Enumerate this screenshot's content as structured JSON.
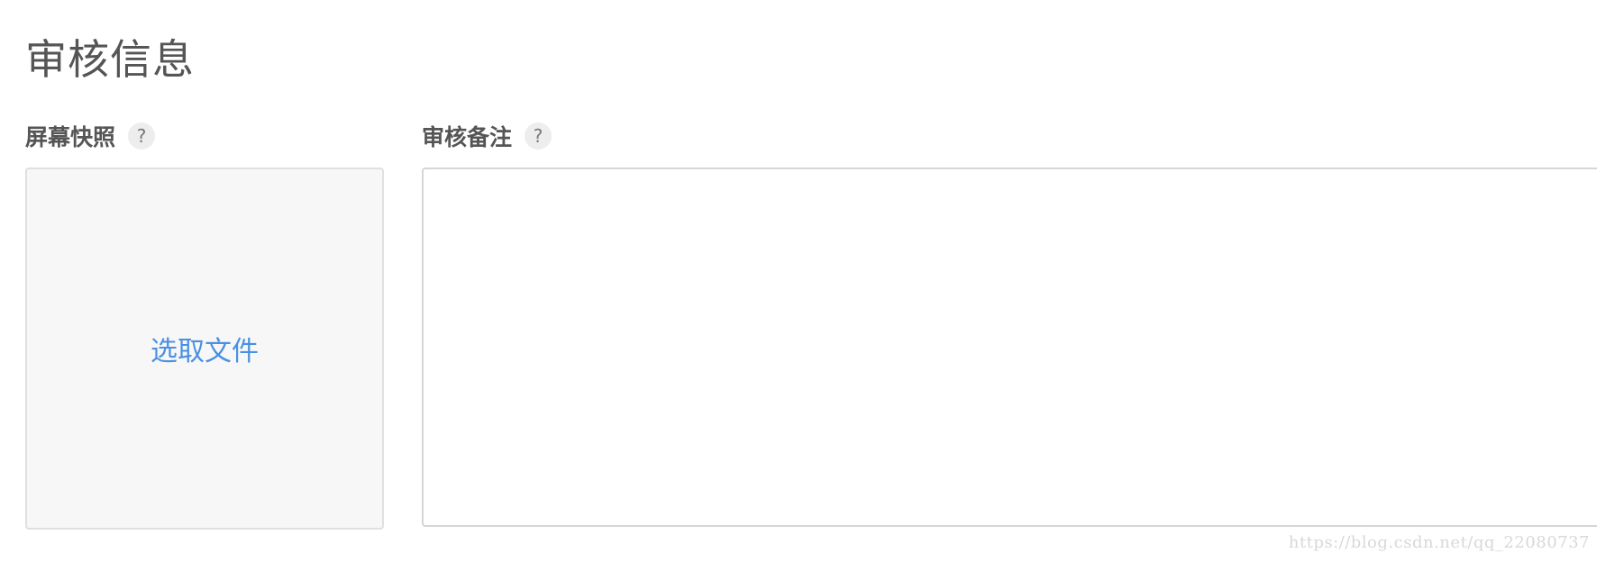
{
  "section": {
    "title": "审核信息"
  },
  "screenshot_field": {
    "label": "屏幕快照",
    "help_icon": "?",
    "upload_label": "选取文件"
  },
  "notes_field": {
    "label": "审核备注",
    "help_icon": "?",
    "value": "",
    "placeholder": ""
  },
  "watermark": {
    "text": "https://blog.csdn.net/qq_22080737"
  },
  "colors": {
    "link": "#4a90e2",
    "text": "#555555",
    "upload_bg": "#f7f7f7",
    "border": "#e0e0e0"
  }
}
